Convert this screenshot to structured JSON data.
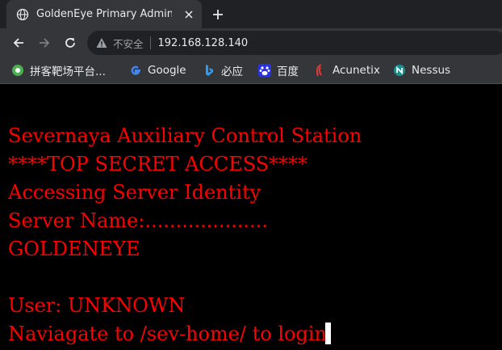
{
  "tab": {
    "title": "GoldenEye Primary Admin Server"
  },
  "omnibox": {
    "security_label": "不安全",
    "url": "192.168.128.140"
  },
  "bookmarks": [
    {
      "label": "拼客靶场平台...",
      "icon": "globe-icon"
    },
    {
      "label": "Google",
      "icon": "google-icon"
    },
    {
      "label": "必应",
      "icon": "bing-icon"
    },
    {
      "label": "百度",
      "icon": "baidu-icon"
    },
    {
      "label": "Acunetix",
      "icon": "acunetix-icon"
    },
    {
      "label": "Nessus",
      "icon": "nessus-icon"
    }
  ],
  "page": {
    "lines": [
      "Severnaya Auxiliary Control Station",
      "****TOP SECRET ACCESS****",
      "Accessing Server Identity",
      "Server Name:....................",
      "GOLDENEYE",
      "User: UNKNOWN",
      "Naviagate to /sev-home/ to login"
    ]
  },
  "colors": {
    "text": "#ff0000",
    "background": "#000000",
    "chrome": "#35363a",
    "tabstrip": "#202124"
  }
}
